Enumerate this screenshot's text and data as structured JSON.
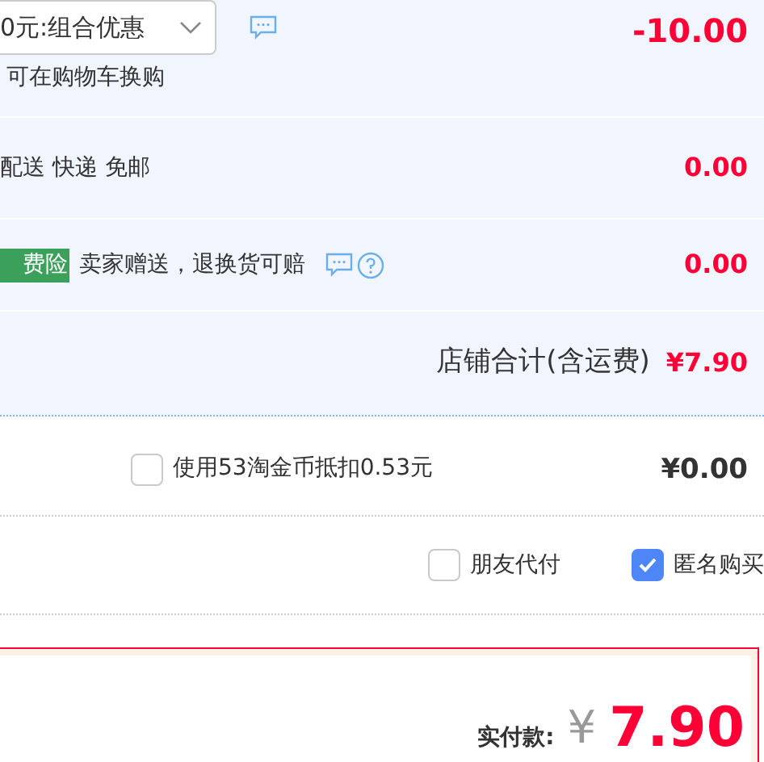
{
  "promo": {
    "dropdown_value": "0元:组合优惠",
    "note": "可在购物车换购",
    "amount": "-10.00"
  },
  "delivery": {
    "text": "配送 快递 免邮",
    "amount": "0.00"
  },
  "insurance": {
    "badge": "费险",
    "text": "卖家赠送，退换货可赔",
    "amount": "0.00"
  },
  "shop_total": {
    "label": "店铺合计(含运费)",
    "amount": "¥7.90"
  },
  "coins": {
    "label": "使用53淘金币抵扣0.53元",
    "checked": false,
    "amount": "¥0.00"
  },
  "options": [
    {
      "label": "朋友代付",
      "checked": false
    },
    {
      "label": "匿名购买",
      "checked": true
    }
  ],
  "payment": {
    "label": "实付款:",
    "currency": "¥",
    "amount": "7.90"
  }
}
